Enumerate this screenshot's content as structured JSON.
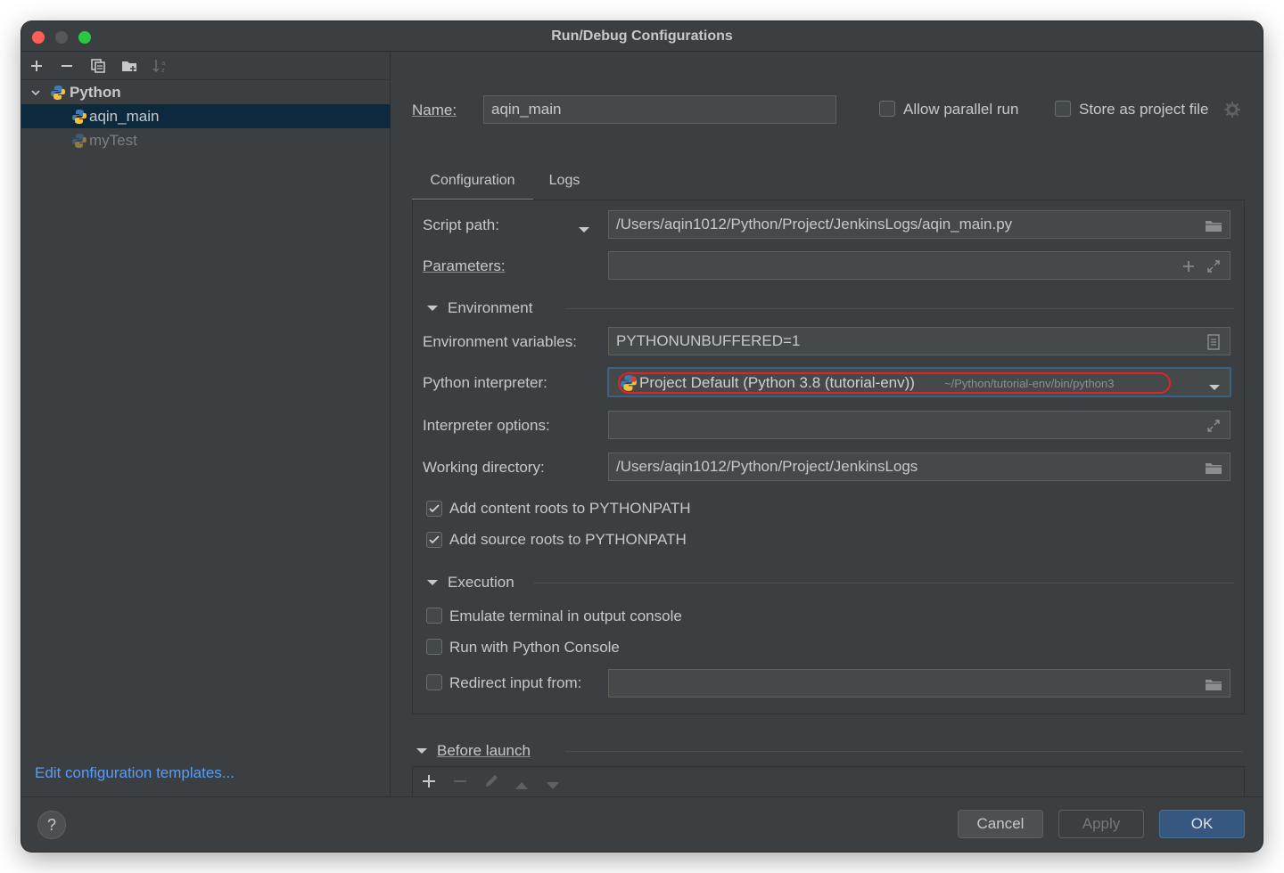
{
  "window": {
    "title": "Run/Debug Configurations"
  },
  "tree": {
    "group": "Python",
    "items": [
      {
        "label": "aqin_main",
        "selected": true
      },
      {
        "label": "myTest",
        "selected": false
      }
    ]
  },
  "left": {
    "edit_templates": "Edit configuration templates..."
  },
  "header": {
    "name_label": "Name:",
    "name_value": "aqin_main",
    "allow_parallel": "Allow parallel run",
    "store_project": "Store as project file"
  },
  "tabs": [
    {
      "label": "Configuration"
    },
    {
      "label": "Logs"
    }
  ],
  "config": {
    "script_path_label": "Script path:",
    "script_path_value": "/Users/aqin1012/Python/Project/JenkinsLogs/aqin_main.py",
    "parameters_label": "Parameters:",
    "parameters_value": "",
    "environment_section": "Environment",
    "env_vars_label": "Environment variables:",
    "env_vars_value": "PYTHONUNBUFFERED=1",
    "interpreter_label": "Python interpreter:",
    "interpreter_value": "Project Default (Python 3.8 (tutorial-env))",
    "interpreter_path": "~/Python/tutorial-env/bin/python3",
    "interp_options_label": "Interpreter options:",
    "interp_options_value": "",
    "workdir_label": "Working directory:",
    "workdir_value": "/Users/aqin1012/Python/Project/JenkinsLogs",
    "add_content_roots": "Add content roots to PYTHONPATH",
    "add_source_roots": "Add source roots to PYTHONPATH",
    "execution_section": "Execution",
    "emulate_terminal": "Emulate terminal in output console",
    "run_python_console": "Run with Python Console",
    "redirect_input": "Redirect input from:",
    "redirect_value": ""
  },
  "before_launch": {
    "label": "Before launch"
  },
  "footer": {
    "help": "?",
    "cancel": "Cancel",
    "apply": "Apply",
    "ok": "OK"
  },
  "colors": {
    "accent": "#4a88c7",
    "link": "#589df6",
    "highlight_circle": "#e0222b",
    "primary_button": "#365880"
  }
}
